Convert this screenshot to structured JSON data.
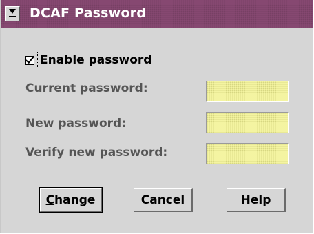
{
  "window": {
    "title": "DCAF Password",
    "system_menu_icon": "system-menu-icon"
  },
  "enable_password": {
    "label": "Enable password",
    "checked": true
  },
  "fields": [
    {
      "label": "Current password:",
      "value": ""
    },
    {
      "label": "New password:",
      "value": ""
    },
    {
      "label": "Verify new password:",
      "value": ""
    }
  ],
  "buttons": {
    "change": {
      "mnemonic": "C",
      "rest": "hange"
    },
    "cancel": "Cancel",
    "help": "Help"
  },
  "colors": {
    "titlebar": "#8a4a74",
    "entry_field": "#fafaa8",
    "dialog_background": "#d6d6d6"
  }
}
